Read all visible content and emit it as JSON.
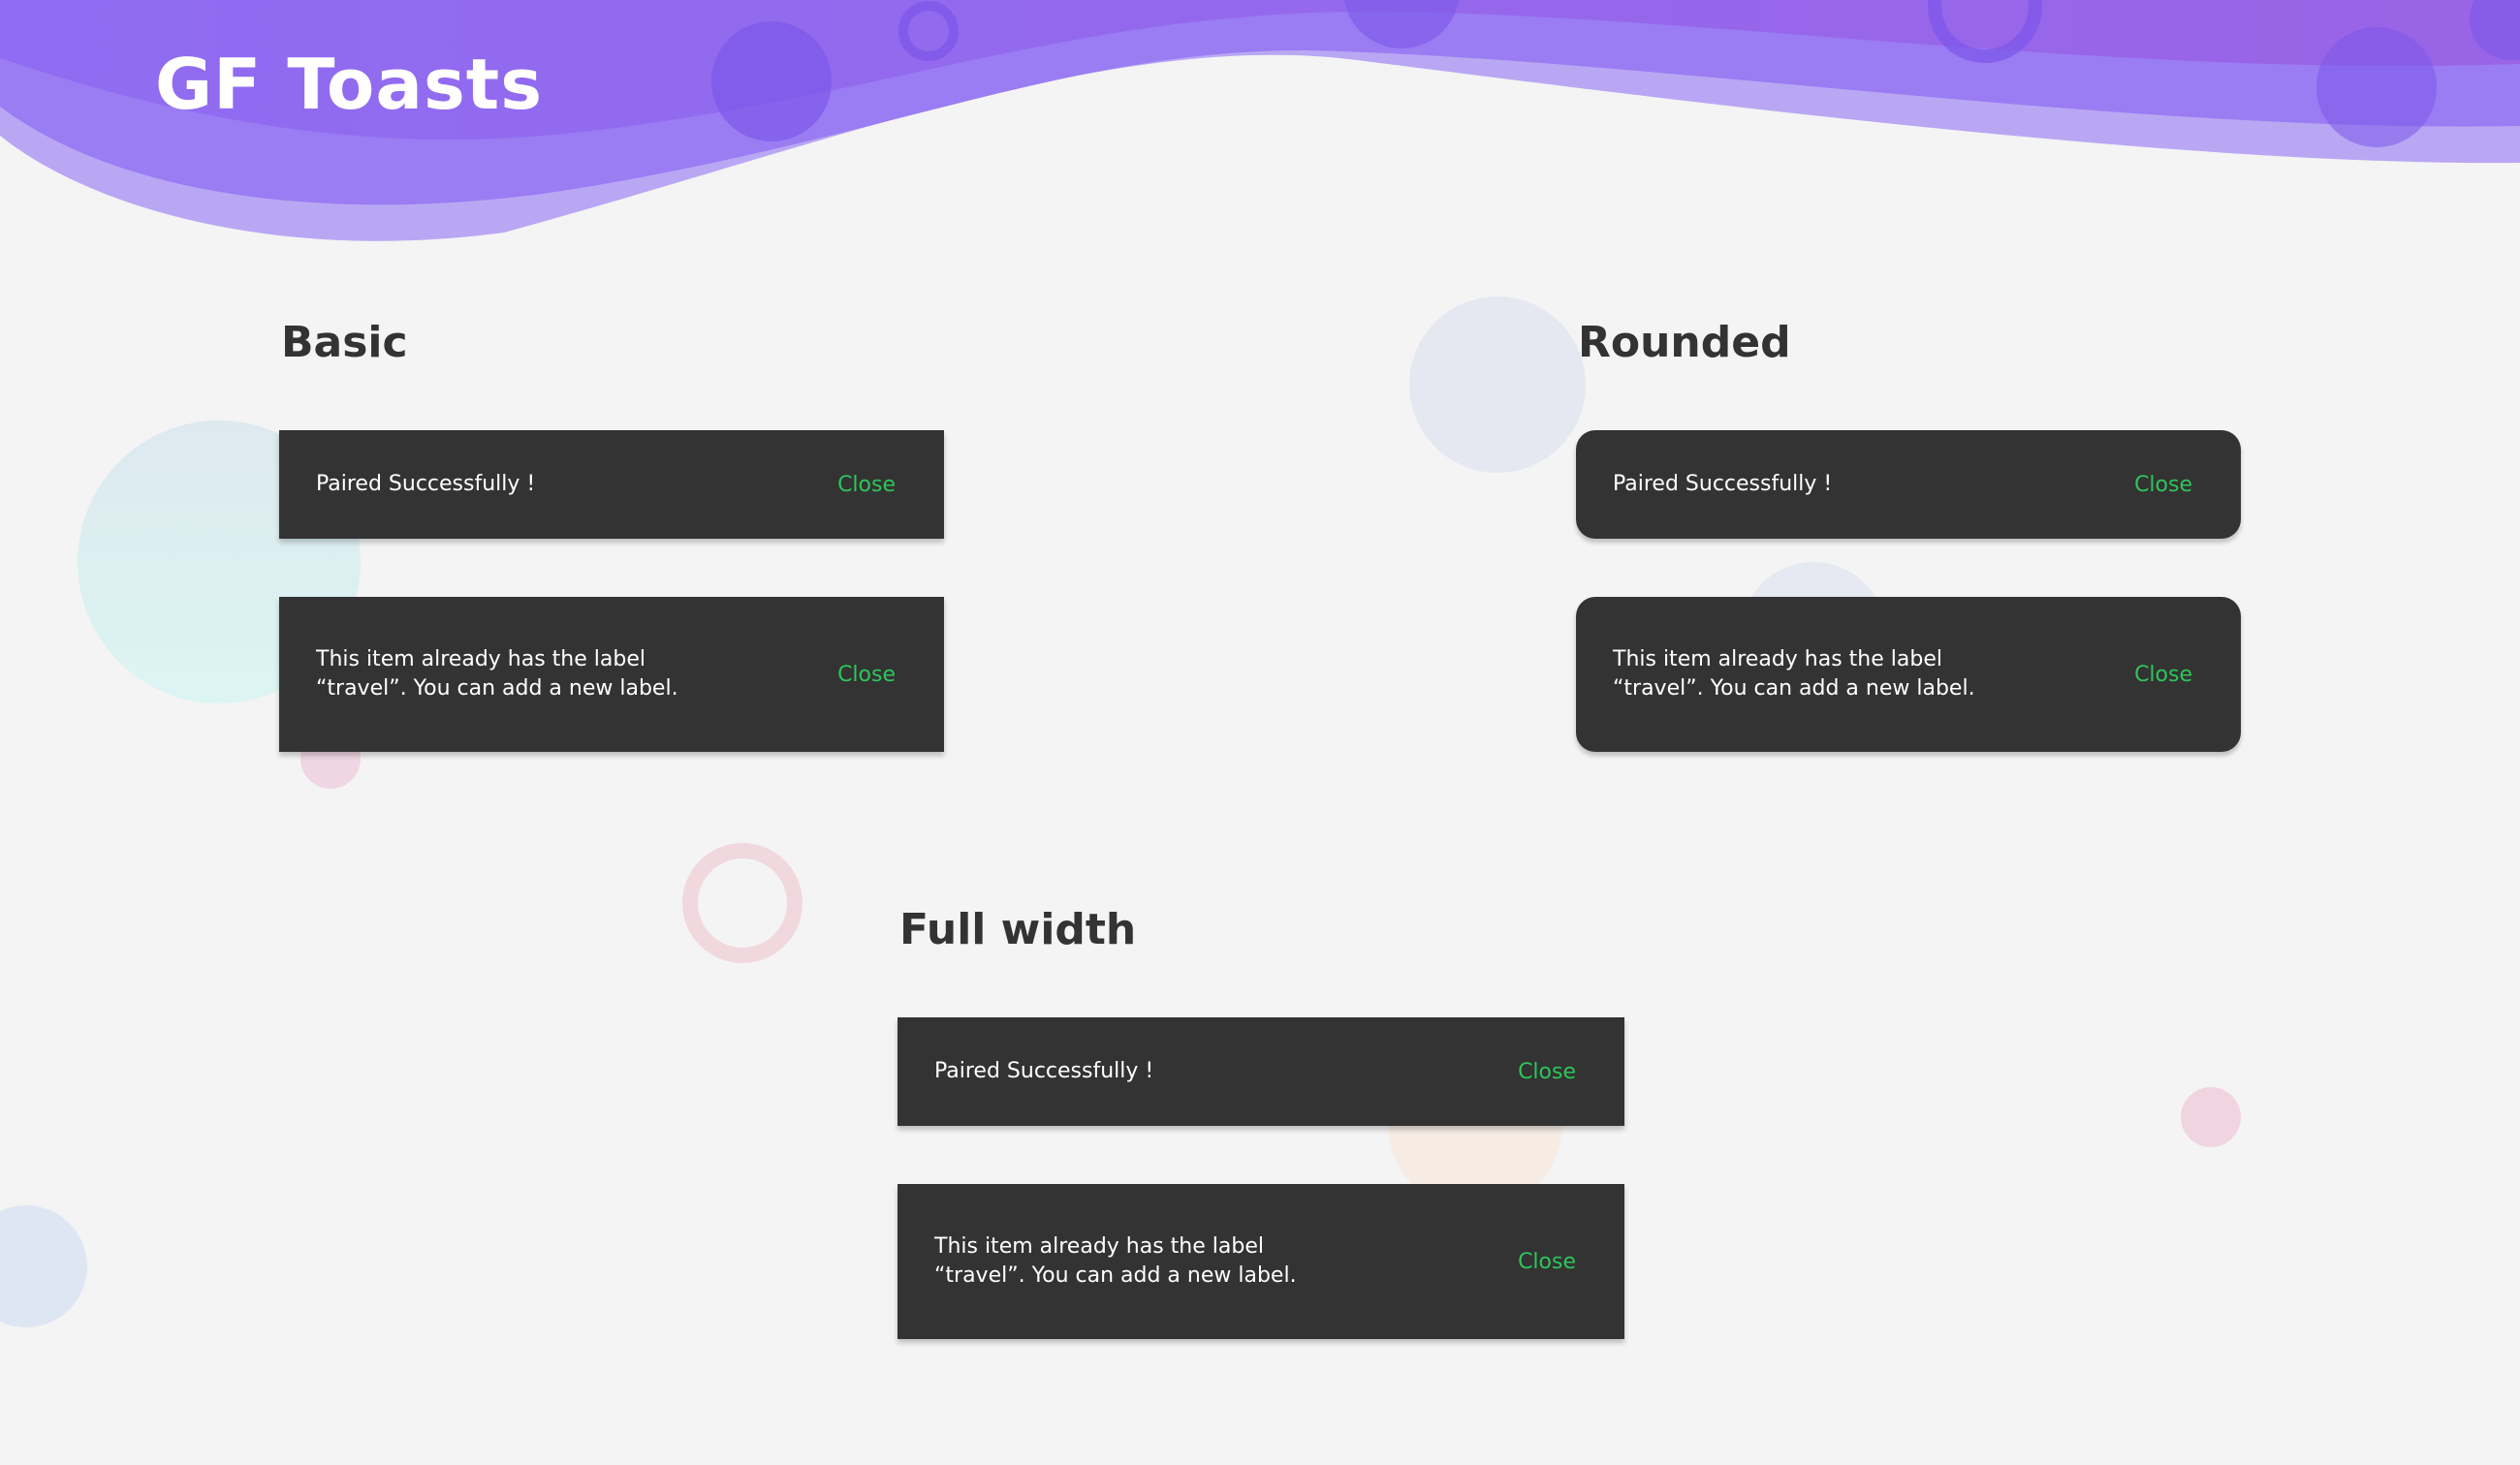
{
  "app": {
    "title": "GF Toasts"
  },
  "colors": {
    "header_purple": "#8b63ee",
    "header_purple_light": "#b9a7f4",
    "page_background": "#f4f4f4",
    "toast_background": "#333333",
    "toast_text": "#ffffff",
    "close_action": "#2ec55a",
    "heading_text": "#333333"
  },
  "sections": {
    "basic": {
      "title": "Basic",
      "toasts": [
        {
          "message": "Paired Successfully !",
          "action": "Close"
        },
        {
          "message": "This item already has the label\n“travel”. You can add a new label.",
          "action": "Close"
        }
      ]
    },
    "rounded": {
      "title": "Rounded",
      "toasts": [
        {
          "message": "Paired Successfully !",
          "action": "Close"
        },
        {
          "message": "This item already has the label\n“travel”. You can add a new label.",
          "action": "Close"
        }
      ]
    },
    "full_width": {
      "title": "Full width",
      "toasts": [
        {
          "message": "Paired Successfully !",
          "action": "Close"
        },
        {
          "message": "This item already has the label\n“travel”. You can add a new label.",
          "action": "Close"
        }
      ]
    }
  }
}
